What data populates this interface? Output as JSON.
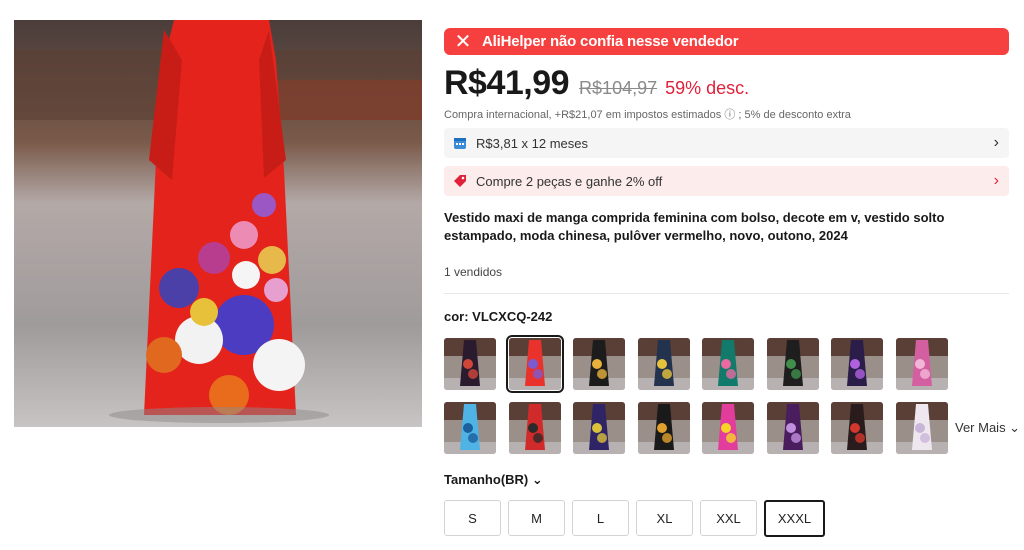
{
  "alert": {
    "icon": "close-icon",
    "text": "AliHelper  não confia nesse vendedor",
    "color": "#f6403f"
  },
  "price": {
    "current": "R$41,99",
    "original": "R$104,97",
    "discount": "59% desc.",
    "tax_note": "Compra internacional, +R$21,07 em impostos estimados ⓘ ; 5% de desconto extra",
    "discount_color": "#e0213a"
  },
  "installments": {
    "icon": "calendar-icon",
    "text": "R$3,81 x 12 meses"
  },
  "promo": {
    "icon": "tag-icon",
    "text": "Compre 2 peças e ganhe 2% off"
  },
  "product": {
    "title": "Vestido maxi de manga comprida feminina com bolso, decote em v, vestido solto estampado, moda chinesa, pulôver vermelho, novo, outono, 2024",
    "sold": "1 vendidos"
  },
  "color": {
    "label": "cor: VLCXCQ-242",
    "selected_index": 1,
    "swatches": [
      {
        "color": "#2a1b2f",
        "accent": "#d0473a"
      },
      {
        "color": "#e8322b",
        "accent": "#7c5bd1"
      },
      {
        "color": "#1c1c1c",
        "accent": "#e7b13c"
      },
      {
        "color": "#23324d",
        "accent": "#e7c33c"
      },
      {
        "color": "#127a6a",
        "accent": "#e86aa0"
      },
      {
        "color": "#1e1e1e",
        "accent": "#3f8f4b"
      },
      {
        "color": "#2b1d4a",
        "accent": "#b061e0"
      },
      {
        "color": "#d45fa0",
        "accent": "#f2b7d8"
      },
      {
        "color": "#4fb3e6",
        "accent": "#1a5f9e"
      },
      {
        "color": "#d12a2a",
        "accent": "#2a2a2a"
      },
      {
        "color": "#2e2466",
        "accent": "#d9c13b"
      },
      {
        "color": "#1a1a1a",
        "accent": "#e0a12d"
      },
      {
        "color": "#e23c9c",
        "accent": "#f6d326"
      },
      {
        "color": "#4a1e5e",
        "accent": "#c28ee0"
      },
      {
        "color": "#2a1c1c",
        "accent": "#d3372d"
      },
      {
        "color": "#efe7ef",
        "accent": "#c9b5d8"
      }
    ],
    "see_more": "Ver Mais ⌄"
  },
  "size": {
    "label": "Tamanho(BR) ⌄",
    "options": [
      "S",
      "M",
      "L",
      "XL",
      "XXL",
      "XXXL"
    ],
    "selected": "XXXL"
  }
}
